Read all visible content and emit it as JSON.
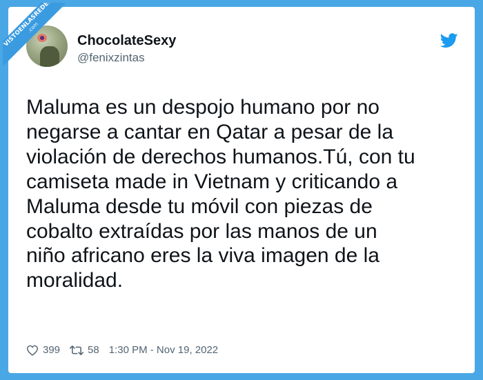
{
  "watermark": {
    "text": "VISTOENLASREDES",
    "suffix": ".com"
  },
  "author": {
    "display_name": "ChocolateSexy",
    "handle": "@fenixzintas"
  },
  "brand": {
    "icon": "twitter-bird-icon",
    "color": "#1d9bf0"
  },
  "tweet": {
    "text": "Maluma es un despojo humano por no\nnegarse a cantar en Qatar a pesar de la\nviolación de derechos humanos.Tú, con tu\ncamiseta made in Vietnam y criticando a\nMaluma desde tu móvil con piezas de\ncobalto extraídas por las manos de un\nniño africano eres la viva imagen de la\nmoralidad."
  },
  "stats": {
    "likes": "399",
    "retweets": "58",
    "timestamp": "1:30 PM - Nov 19, 2022"
  },
  "colors": {
    "background": "#4aa7e6",
    "card": "#ffffff",
    "text": "#0f1419",
    "secondary_text": "#536471"
  }
}
